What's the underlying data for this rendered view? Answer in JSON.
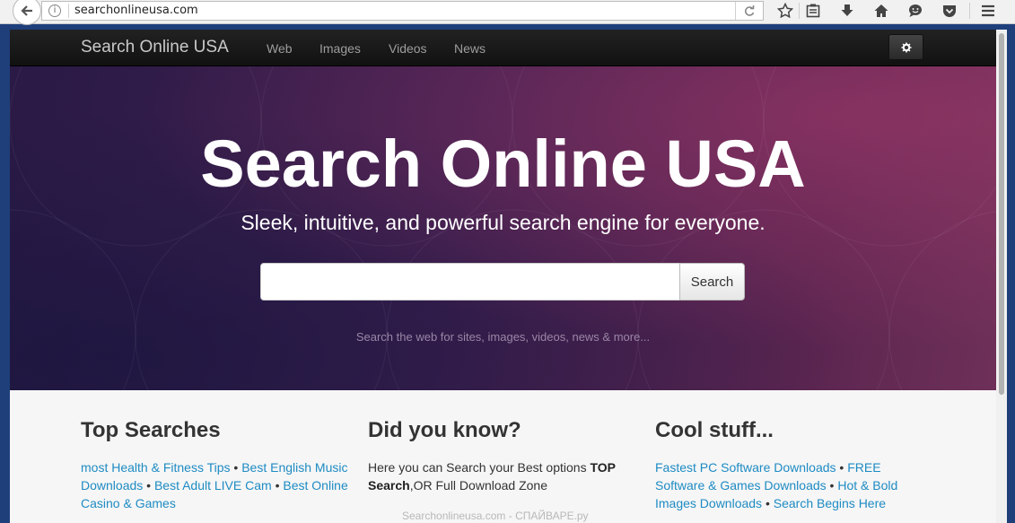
{
  "browser": {
    "url": "searchonlineusa.com"
  },
  "navbar": {
    "brand": "Search Online USA",
    "links": [
      "Web",
      "Images",
      "Videos",
      "News"
    ]
  },
  "hero": {
    "title": "Search Online USA",
    "subtitle": "Sleek, intuitive, and powerful search engine for everyone.",
    "search_placeholder": "",
    "search_button": "Search",
    "hint": "Search the web for sites, images, videos, news & more..."
  },
  "columns": {
    "top_searches": {
      "title": "Top Searches",
      "links": [
        "most Health & Fitness Tips",
        "Best English Music Downloads",
        "Best Adult LIVE Cam",
        "Best Online Casino & Games"
      ]
    },
    "did_you_know": {
      "title": "Did you know?",
      "text_1": "Here you can Search your Best options ",
      "bold_1": "TOP Search",
      "text_2": ",OR Full Download Zone"
    },
    "cool_stuff": {
      "title": "Cool stuff...",
      "links": [
        "Fastest PC Software Downloads",
        "FREE Software & Games Downloads",
        "Hot & Bold Images Downloads",
        "Search Begins Here"
      ]
    },
    "bullet": "•"
  },
  "watermark": "Searchonlineusa.com - СПАЙВАРЕ.ру",
  "colors": {
    "link": "#1e8bc3",
    "navbar": "#1a1a1a",
    "hero_purple": "#3c1f4f"
  }
}
